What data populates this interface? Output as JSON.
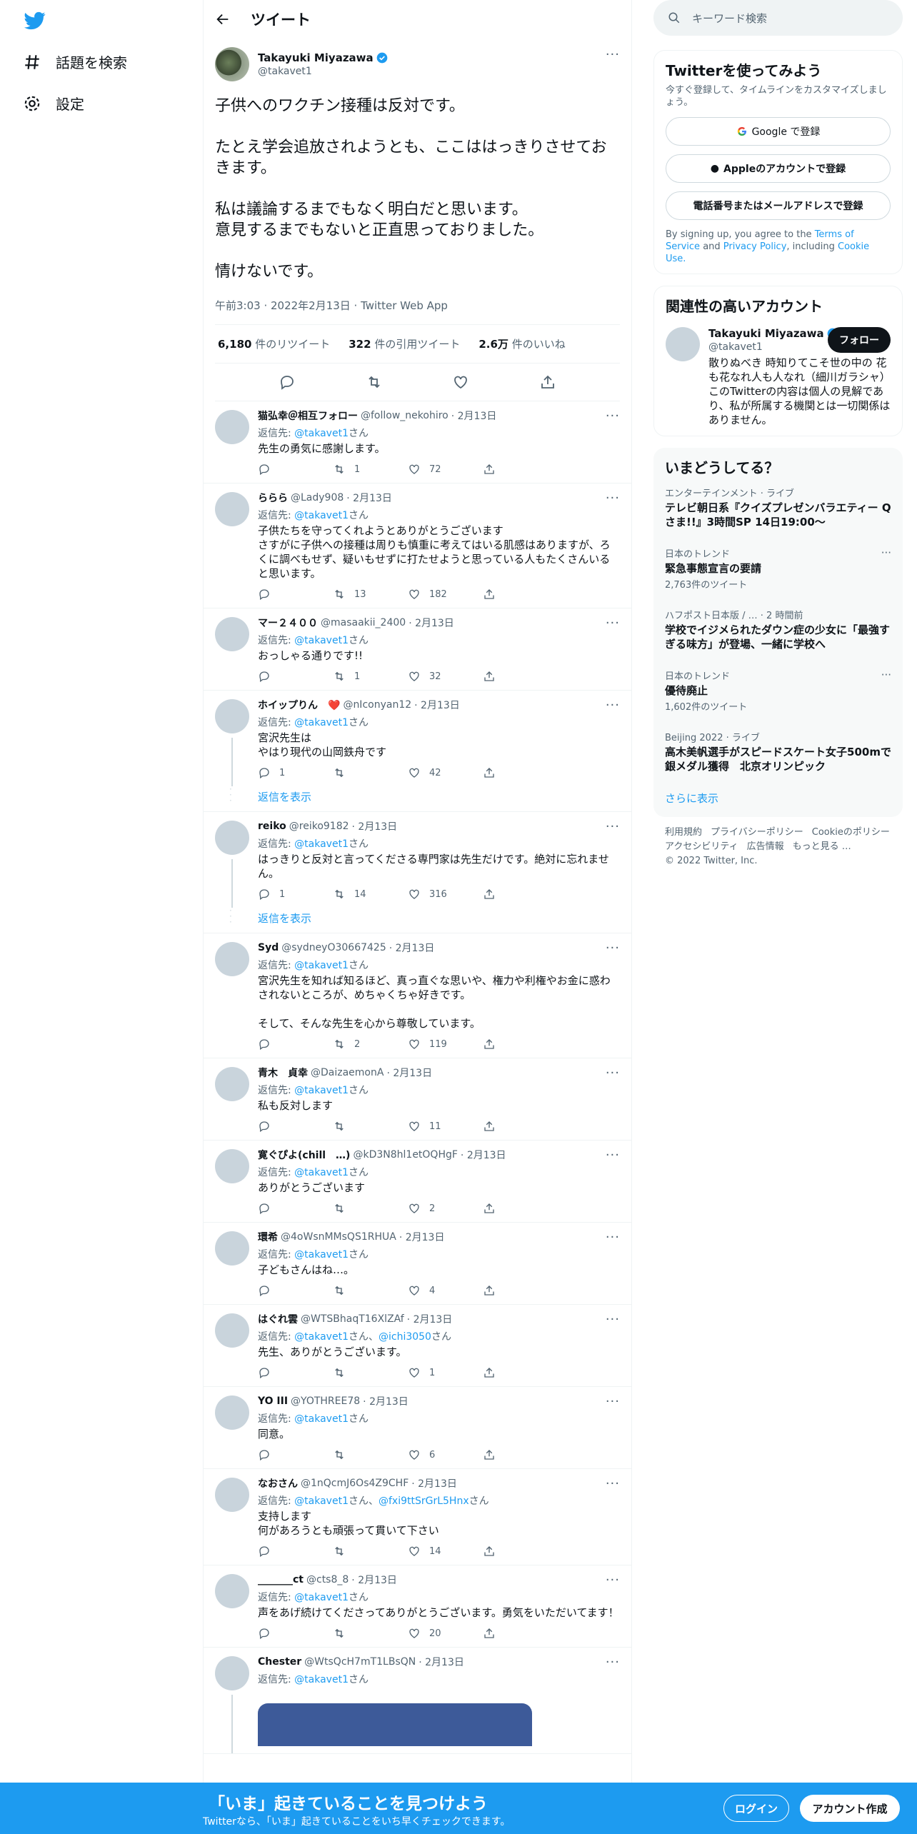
{
  "nav": {
    "explore": "話題を検索",
    "settings": "設定"
  },
  "header": {
    "title": "ツイート"
  },
  "main_tweet": {
    "name": "Takayuki Miyazawa",
    "handle": "@takavet1",
    "lines": [
      "子供へのワクチン接種は反対です。",
      "",
      "たとえ学会追放されようとも、ここははっきりさせておきます。",
      "",
      "私は議論するまでもなく明白だと思います。",
      "意見するまでもないと正直思っておりました。",
      "",
      "情けないです。"
    ],
    "meta": "午前3:03 · 2022年2月13日 · Twitter Web App",
    "retweets": "6,180",
    "retweets_label": "件のリツイート",
    "quotes": "322",
    "quotes_label": "件の引用ツイート",
    "likes": "2.6万",
    "likes_label": "件のいいね"
  },
  "replies": [
    {
      "name": "猫弘幸＠相互フォロー",
      "handle": "@follow_nekohiro",
      "date": "· 2月13日",
      "to": "@takavet1",
      "text": "先生の勇気に感謝します。",
      "reply_count": "",
      "rt": "1",
      "like": "72"
    },
    {
      "name": "ららら",
      "handle": "@Lady908",
      "date": "· 2月13日",
      "to": "@takavet1",
      "text": "子供たちを守ってくれようとありがとうございます\nさすがに子供への接種は周りも慎重に考えてはいる肌感はありますが、ろくに調べもせず、疑いもせずに打たせようと思っている人もたくさんいると思います。",
      "reply_count": "",
      "rt": "13",
      "like": "182"
    },
    {
      "name": "マー２４００",
      "handle": "@masaakii_2400",
      "date": "· 2月13日",
      "to": "@takavet1",
      "text": "おっしゃる通りです!!",
      "reply_count": "",
      "rt": "1",
      "like": "32"
    },
    {
      "name": "ホイップりん　❤️",
      "handle": "@nIconyan12",
      "date": "· 2月13日",
      "to": "@takavet1",
      "text": "宮沢先生は\nやはり現代の山岡鉄舟です",
      "reply_count": "1",
      "rt": "",
      "like": "42"
    },
    {
      "name": "reiko",
      "handle": "@reiko9182",
      "date": "· 2月13日",
      "to": "@takavet1",
      "text": "はっきりと反対と言ってくださる専門家は先生だけです。絶対に忘れません。",
      "reply_count": "1",
      "rt": "14",
      "like": "316"
    },
    {
      "name": "Syd",
      "handle": "@sydneyO30667425",
      "date": "· 2月13日",
      "to": "@takavet1",
      "text": "宮沢先生を知れば知るほど、真っ直ぐな思いや、権力や利権やお金に惑わされないところが、めちゃくちゃ好きです。\n\nそして、そんな先生を心から尊敬しています。",
      "reply_count": "",
      "rt": "2",
      "like": "119"
    },
    {
      "name": "青木　貞幸",
      "handle": "@DaizaemonA",
      "date": "· 2月13日",
      "to": "@takavet1",
      "text": "私も反対します",
      "reply_count": "",
      "rt": "",
      "like": "11"
    },
    {
      "name": "寛ぐぴよ(chill　…)",
      "handle": "@kD3N8hl1etOQHgF",
      "date": "· 2月13日",
      "to": "@takavet1",
      "text": "ありがとうございます",
      "reply_count": "",
      "rt": "",
      "like": "2"
    },
    {
      "name": "環希",
      "handle": "@4oWsnMMsQS1RHUA",
      "date": "· 2月13日",
      "to": "@takavet1",
      "text": "子どもさんはね…。",
      "reply_count": "",
      "rt": "",
      "like": "4"
    },
    {
      "name": "はぐれ雲",
      "handle": "@WTSBhaqT16XlZAf",
      "date": "· 2月13日",
      "to": "@takavet1",
      "to2": "@ichi3050",
      "text": "先生、ありがとうございます。",
      "reply_count": "",
      "rt": "",
      "like": "1"
    },
    {
      "name": "YO III",
      "handle": "@YOTHREE78",
      "date": "· 2月13日",
      "to": "@takavet1",
      "text": "同意。",
      "reply_count": "",
      "rt": "",
      "like": "6"
    },
    {
      "name": "なおさん",
      "handle": "@1nQcmJ6Os4Z9CHF",
      "date": "· 2月13日",
      "to": "@takavet1",
      "to2": "@fxi9ttSrGrL5Hnx",
      "text": "支持します\n何があろうとも頑張って貫いて下さい",
      "reply_count": "",
      "rt": "",
      "like": "14"
    },
    {
      "name": "_______ct",
      "handle": "@cts8_8",
      "date": "· 2月13日",
      "to": "@takavet1",
      "text": "声をあげ続けてくださってありがとうございます。勇気をいただいてます！",
      "reply_count": "",
      "rt": "",
      "like": "20"
    },
    {
      "name": "Chester",
      "handle": "@WtsQcH7mT1LBsQN",
      "date": "· 2月13日",
      "to": "@takavet1"
    }
  ],
  "reply_to_label": "返信先:",
  "san": "さん",
  "show_replies": "返信を表示",
  "right": {
    "search_placeholder": "キーワード検索",
    "signup_title": "Twitterを使ってみよう",
    "signup_sub": "今すぐ登録して、タイムラインをカスタマイズしましょう。",
    "google_btn": "Google で登録",
    "apple_btn": "Appleのアカウントで登録",
    "phone_btn": "電話番号またはメールアドレスで登録",
    "tos_1": "By signing up, you agree to the",
    "tos_terms": "Terms of Service",
    "tos_and": "and",
    "tos_privacy": "Privacy Policy",
    "tos_including": ", including",
    "tos_cookie": "Cookie Use.",
    "relevant_title": "関連性の高いアカウント",
    "rel_name": "Takayuki Miyazawa",
    "rel_handle": "@takavet1",
    "follow_btn": "フォロー",
    "rel_bio": "散りぬべき 時知りてこそ世の中の 花も花なれ人も人なれ（細川ガラシャ）このTwitterの内容は個人の見解であり、私が所属する機関とは一切関係はありません。",
    "trends_title": "いまどうしてる？",
    "trends": [
      {
        "cat": "エンターテインメント · ライブ",
        "title": "テレビ朝日系『クイズプレゼンバラエティー Qさま!!』3時間SP 14日19:00〜",
        "count": ""
      },
      {
        "cat": "日本のトレンド",
        "title": "緊急事態宣言の要請",
        "count": "2,763件のツイート"
      },
      {
        "cat": "ハフポスト日本版 / … · 2 時間前",
        "title": "学校でイジメられたダウン症の少女に「最強すぎる味方」が登場、一緒に学校へ",
        "count": ""
      },
      {
        "cat": "日本のトレンド",
        "title": "優待廃止",
        "count": "1,602件のツイート"
      },
      {
        "cat": "Beijing 2022 · ライブ",
        "title": "高木美帆選手がスピードスケート女子500mで銀メダル獲得　北京オリンピック",
        "count": ""
      }
    ],
    "show_more": "さらに表示",
    "footer": [
      "利用規約",
      "プライバシーポリシー",
      "Cookieのポリシー",
      "アクセシビリティ",
      "広告情報",
      "もっと見る …",
      "© 2022 Twitter, Inc."
    ]
  },
  "banner": {
    "title": "「いま」起きていることを見つけよう",
    "sub": "Twitterなら、「いま」起きていることをいち早くチェックできます。",
    "login": "ログイン",
    "signup": "アカウント作成"
  },
  "colors": {
    "accent": "#1d9bf0",
    "text": "#0f1419",
    "muted": "#536471"
  }
}
